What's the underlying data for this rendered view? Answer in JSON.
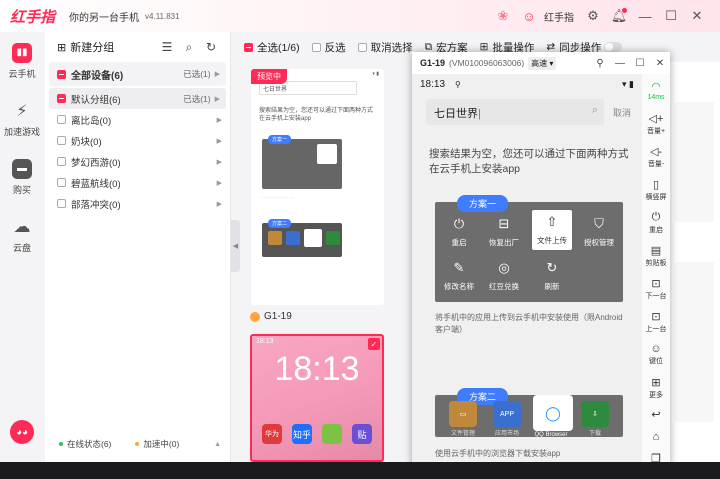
{
  "titlebar": {
    "logo": "红手指",
    "tagline": "你的另一台手机",
    "version": "v4.11.831",
    "username": "红手指",
    "icons": [
      "gift-icon",
      "user-icon",
      "settings-icon",
      "bell-icon",
      "minimize-icon",
      "maximize-icon",
      "close-icon"
    ]
  },
  "leftnav": {
    "items": [
      {
        "label": "云手机",
        "icon": "cloud-phone-icon"
      },
      {
        "label": "加速游戏",
        "icon": "lightning-icon"
      },
      {
        "label": "购买",
        "icon": "shopping-bag-icon"
      },
      {
        "label": "云盘",
        "icon": "cloud-drive-icon"
      }
    ]
  },
  "groups": {
    "new_group": "新建分组",
    "all_devices": {
      "label": "全部设备(6)",
      "selected": "已选(1)"
    },
    "default_group": {
      "label": "默认分组(6)",
      "selected": "已选(1)"
    },
    "items": [
      "离比岛(0)",
      "奶块(0)",
      "梦幻西游(0)",
      "碧蓝航线(0)",
      "部落冲突(0)"
    ],
    "status_online": "在线状态(6)",
    "status_accelerating": "加速中(0)"
  },
  "toolbar": {
    "select_all": "全选(1/6)",
    "invert": "反选",
    "cancel": "取消选择",
    "hongfang": "宏方案",
    "batch": "批量操作",
    "sync": "同步操作"
  },
  "card1": {
    "badge": "预览中",
    "search": "七日世界",
    "msg": "搜索结果为空，您还可以通过下面两种方式在云手机上安装app",
    "plan1": "方案一",
    "plan2": "方案二",
    "name": "G1-19"
  },
  "card2": {
    "time": "18:13",
    "status_time": "18:13",
    "apps": [
      "华为",
      "知乎",
      "",
      "贴"
    ]
  },
  "popup": {
    "device": "G1-19",
    "vm": "(VM010096063006)",
    "quality": "高速",
    "phone": {
      "time": "18:13",
      "search": "七日世界",
      "cancel": "取消",
      "message": "搜索结果为空，您还可以通过下面两种方式在云手机上安装app",
      "plan1_label": "方案一",
      "plan1_items": [
        {
          "label": "重启",
          "icon": "power-icon"
        },
        {
          "label": "恢复出厂",
          "icon": "reset-icon"
        },
        {
          "label": "文件上传",
          "icon": "upload-icon"
        },
        {
          "label": "授权管理",
          "icon": "shield-icon"
        },
        {
          "label": "修改名称",
          "icon": "pen-icon"
        },
        {
          "label": "红豆兑换",
          "icon": "bean-icon"
        },
        {
          "label": "刷新",
          "icon": "refresh-icon"
        }
      ],
      "plan1_note": "将手机中的应用上传到云手机中安装使用（限Android客户端）",
      "plan2_label": "方案二",
      "plan2_items": [
        {
          "label": "文件管理",
          "icon": "folder-icon"
        },
        {
          "label": "应用市场",
          "icon": "app-store-icon"
        },
        {
          "label": "QQ Browser",
          "icon": "qq-browser-icon"
        },
        {
          "label": "下载",
          "icon": "download-icon"
        }
      ],
      "plan2_note": "使用云手机中的浏览器下载安装app"
    },
    "tools": [
      {
        "label": "14ms",
        "icon": "wifi-icon"
      },
      {
        "label": "音量+",
        "icon": "volume-up-icon"
      },
      {
        "label": "音量-",
        "icon": "volume-down-icon"
      },
      {
        "label": "横竖屏",
        "icon": "rotate-icon"
      },
      {
        "label": "重启",
        "icon": "power-icon"
      },
      {
        "label": "剪贴板",
        "icon": "clipboard-icon"
      },
      {
        "label": "下一台",
        "icon": "next-device-icon"
      },
      {
        "label": "上一台",
        "icon": "prev-device-icon"
      },
      {
        "label": "键位",
        "icon": "keymap-icon"
      },
      {
        "label": "更多",
        "icon": "more-icon"
      }
    ]
  },
  "colors": {
    "accent": "#ff2a55",
    "plan_label": "#3f7cff",
    "online": "#2ec25b",
    "accelerating": "#ffa53a",
    "signal": "#17c04a"
  }
}
